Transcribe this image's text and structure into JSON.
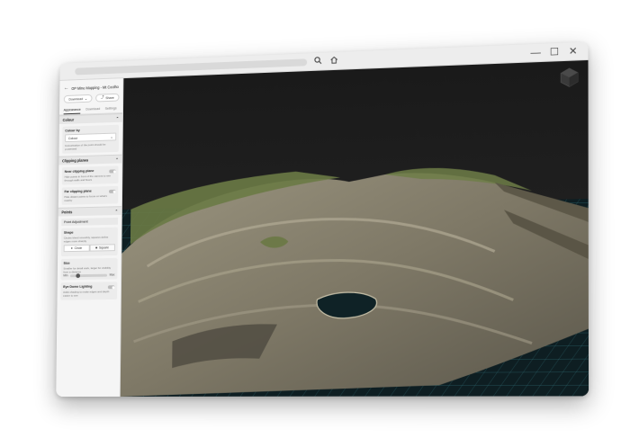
{
  "window": {
    "controls": {
      "minimize": "—",
      "maximize": "☐",
      "close": "✕"
    }
  },
  "sidebar": {
    "title": "OP Mine Mapping - Mt Coolho...",
    "download_button": "Download",
    "share_button": "Share",
    "tabs": [
      {
        "label": "Appearance"
      },
      {
        "label": "Download"
      },
      {
        "label": "Settings"
      }
    ],
    "colour": {
      "header": "Colour",
      "colour_by_label": "Colour by",
      "selected": "Colour",
      "hint": "Colourisation of the point should be processed"
    },
    "clipping": {
      "header": "Clipping planes",
      "near_label": "Near clipping plane",
      "near_hint": "Hide points in front of the camera to see through walls and floors",
      "far_label": "Far clipping plane",
      "far_hint": "Hide distant points to focus on what's nearby"
    },
    "points": {
      "header": "Points",
      "adjustment_label": "Point Adjustment",
      "shape_label": "Shape",
      "shape_hint": "Circles blend smoothly, squares define edges more sharply",
      "shape_options": [
        "Circle",
        "Square"
      ],
      "size_label": "Size",
      "size_hint": "Smaller for detail work, larger for visibility from a distance",
      "size_min": "Min",
      "size_max": "Max",
      "size_value": 0.15,
      "edl_label": "Eye Dome Lighting",
      "edl_hint": "Adds shading to make edges and depth easier to see"
    }
  },
  "viewport": {
    "colors": {
      "sky": "#1c1c1c",
      "grid": "#2f6f78",
      "terrain": "#8a8472",
      "vegetation": "#6a7a45"
    }
  }
}
